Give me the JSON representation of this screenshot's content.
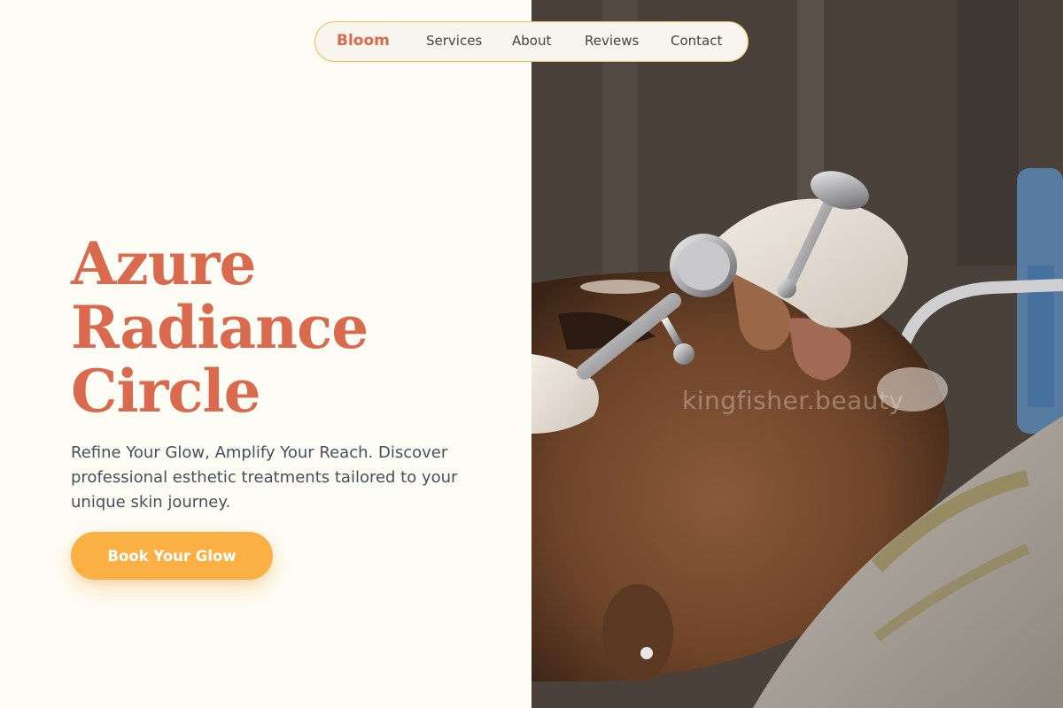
{
  "nav": {
    "brand": "Bloom",
    "links": [
      "Services",
      "About",
      "Reviews",
      "Contact"
    ]
  },
  "hero": {
    "title_lines": [
      "Azure",
      "Radiance",
      "Circle"
    ],
    "subtitle": "Refine Your Glow, Amplify Your Reach. Discover professional esthetic treatments tailored to your unique skin journey.",
    "cta_label": "Book Your Glow"
  },
  "photo": {
    "watermark": "kingfisher.beauty"
  },
  "colors": {
    "accent": "#d96a4e",
    "cta": "#fbb043",
    "nav_border": "#f1bf63",
    "background": "#fdfcf5",
    "body_text": "#46505a"
  }
}
